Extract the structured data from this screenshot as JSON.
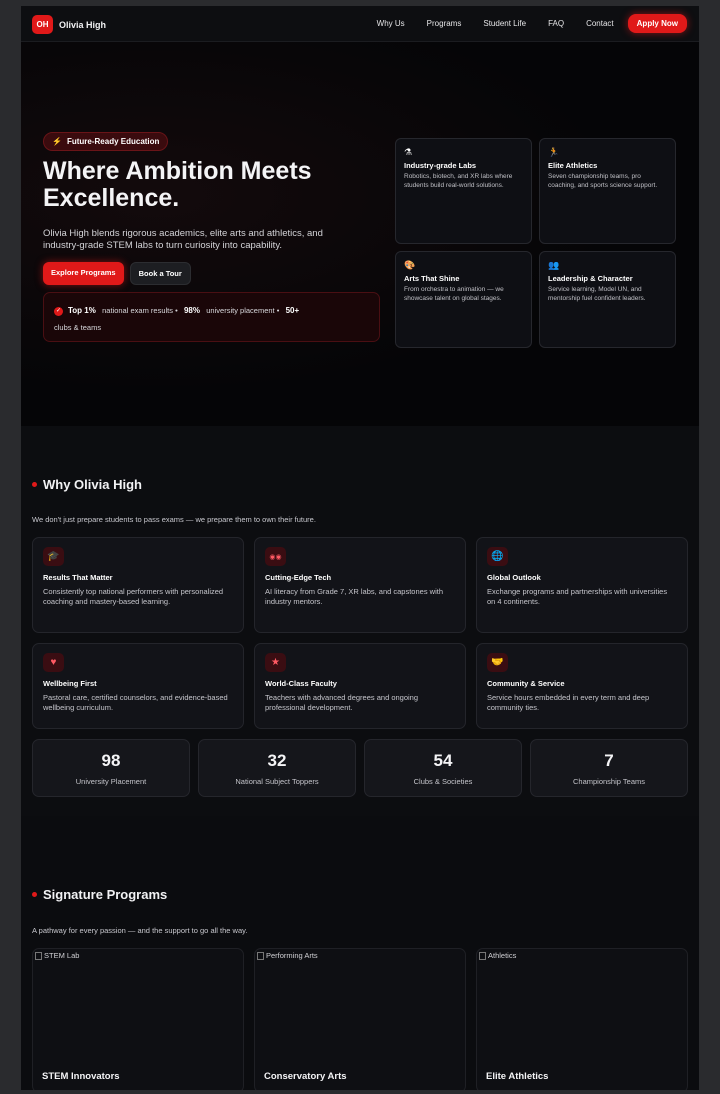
{
  "brand": {
    "logo": "OH",
    "name": "Olivia High"
  },
  "nav": {
    "links": [
      "Why Us",
      "Programs",
      "Student Life",
      "FAQ",
      "Contact"
    ],
    "apply": "Apply Now"
  },
  "hero": {
    "pill": "Future-Ready Education",
    "title": "Where Ambition Meets Excellence.",
    "description": "Olivia High blends rigorous academics, elite arts and athletics, and industry-grade STEM labs to turn curiosity into capability.",
    "primary_button": "Explore Programs",
    "secondary_button": "Book a Tour",
    "stats": [
      {
        "value": "Top 1%",
        "label": "national exam results •"
      },
      {
        "value": "98%",
        "label": "university placement •"
      },
      {
        "value": "50+",
        "label": "clubs & teams"
      }
    ],
    "features": [
      {
        "icon": "microscope-icon",
        "glyph": "⚗",
        "title": "Industry-grade Labs",
        "desc": "Robotics, biotech, and XR labs where students build real-world solutions."
      },
      {
        "icon": "running-icon",
        "glyph": "🏃",
        "title": "Elite Athletics",
        "desc": "Seven championship teams, pro coaching, and sports science support."
      },
      {
        "icon": "palette-icon",
        "glyph": "🎨",
        "title": "Arts That Shine",
        "desc": "From orchestra to animation — we showcase talent on global stages."
      },
      {
        "icon": "people-icon",
        "glyph": "👥",
        "title": "Leadership & Character",
        "desc": "Service learning, Model UN, and mentorship fuel confident leaders."
      }
    ]
  },
  "why": {
    "title": "Why Olivia High",
    "subtitle": "We don't just prepare students to pass exams — we prepare them to own their future.",
    "cards": [
      {
        "icon": "graduation-cap-icon",
        "glyph": "🎓",
        "title": "Results That Matter",
        "desc": "Consistently top national performers with personalized coaching and mastery-based learning."
      },
      {
        "icon": "vr-headset-icon",
        "glyph": "◉◉",
        "title": "Cutting-Edge Tech",
        "desc": "AI literacy from Grade 7, XR labs, and capstones with industry mentors."
      },
      {
        "icon": "globe-icon",
        "glyph": "🌐",
        "title": "Global Outlook",
        "desc": "Exchange programs and partnerships with universities on 4 continents."
      },
      {
        "icon": "shield-heart-icon",
        "glyph": "♥",
        "title": "Wellbeing First",
        "desc": "Pastoral care, certified counselors, and evidence-based wellbeing curriculum."
      },
      {
        "icon": "star-icon",
        "glyph": "★",
        "title": "World-Class Faculty",
        "desc": "Teachers with advanced degrees and ongoing professional development."
      },
      {
        "icon": "handshake-icon",
        "glyph": "🤝",
        "title": "Community & Service",
        "desc": "Service hours embedded in every term and deep community ties."
      }
    ],
    "stats": [
      {
        "value": "98",
        "label": "University Placement"
      },
      {
        "value": "32",
        "label": "National Subject Toppers"
      },
      {
        "value": "54",
        "label": "Clubs & Societies"
      },
      {
        "value": "7",
        "label": "Championship Teams"
      }
    ]
  },
  "programs": {
    "title": "Signature Programs",
    "subtitle": "A pathway for every passion — and the support to go all the way.",
    "cards": [
      {
        "alt": "STEM Lab",
        "name": "STEM Innovators"
      },
      {
        "alt": "Performing Arts",
        "name": "Conservatory Arts"
      },
      {
        "alt": "Athletics",
        "name": "Elite Athletics"
      }
    ]
  }
}
